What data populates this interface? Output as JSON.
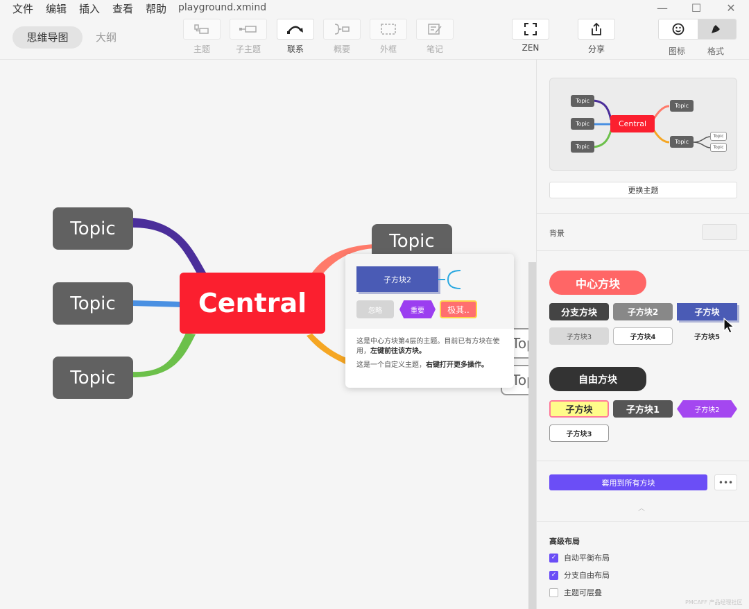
{
  "menu": {
    "items": [
      "文件",
      "编辑",
      "插入",
      "查看",
      "帮助"
    ],
    "filename": "playground.xmind"
  },
  "window_controls": {
    "minimize": "—",
    "maximize": "☐",
    "close": "✕"
  },
  "toolbar": {
    "view_tabs": {
      "mindmap": "思维导图",
      "outline": "大纲"
    },
    "tools": [
      {
        "label": "主题",
        "icon": "topic-icon"
      },
      {
        "label": "子主题",
        "icon": "subtopic-icon"
      },
      {
        "label": "联系",
        "icon": "relationship-icon"
      },
      {
        "label": "概要",
        "icon": "summary-icon"
      },
      {
        "label": "外框",
        "icon": "boundary-icon"
      },
      {
        "label": "笔记",
        "icon": "note-icon"
      }
    ],
    "zen": "ZEN",
    "share": "分享",
    "icons_label": "图标",
    "format_label": "格式"
  },
  "canvas": {
    "central": "Central",
    "left_topics": [
      "Topic",
      "Topic",
      "Topic"
    ],
    "right_topics": [
      "Topic",
      "Top",
      "Top"
    ],
    "branch_colors": {
      "purple": "#4b2e9a",
      "blue": "#4a90e2",
      "green": "#6cc04a",
      "salmon": "#ff7a6a",
      "orange": "#f5a623"
    }
  },
  "popup": {
    "preview_block": "子方块2",
    "chips": [
      "忽略",
      "重要",
      "极其.."
    ],
    "desc1_prefix": "这是中心方块第4层的主题。目前已有方块在使用，",
    "desc1_bold": "左键前往该方块。",
    "desc2_prefix": "这是一个自定义主题，",
    "desc2_bold": "右键打开更多操作。"
  },
  "panel": {
    "preview": {
      "central": "Central",
      "topic": "Topic"
    },
    "change_theme": "更换主题",
    "background_label": "背景",
    "central_block": "中心方块",
    "central_chips": [
      "分支方块",
      "子方块2",
      "子方块",
      "子方块3",
      "子方块4",
      "子方块5"
    ],
    "free_block": "自由方块",
    "free_chips": [
      "子方块",
      "子方块1",
      "子方块2",
      "子方块3"
    ],
    "apply_all": "套用到所有方块",
    "more": "•••",
    "advanced_title": "高级布局",
    "checks": [
      {
        "label": "自动平衡布局",
        "checked": true
      },
      {
        "label": "分支自由布局",
        "checked": true
      },
      {
        "label": "主题可层叠",
        "checked": false
      }
    ],
    "watermark": "PMCAFF 产品经理社区",
    "accent": "#6b4ef6"
  }
}
